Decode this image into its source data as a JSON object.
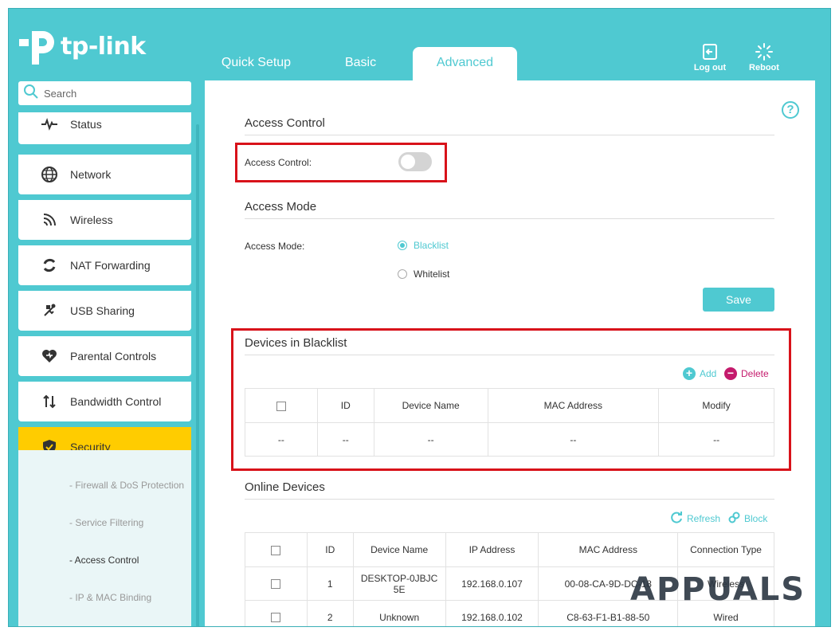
{
  "brand": {
    "name": "tp-link",
    "accent": "#4fc9d1",
    "active_menu": "#ffcc00",
    "highlight": "#d8121a"
  },
  "tabs": [
    {
      "label": "Quick Setup"
    },
    {
      "label": "Basic"
    },
    {
      "label": "Advanced",
      "active": true
    }
  ],
  "header_buttons": {
    "logout": "Log out",
    "reboot": "Reboot"
  },
  "search": {
    "placeholder": "Search"
  },
  "sidebar": {
    "items": [
      {
        "label": "Status",
        "icon": "pulse-icon"
      },
      {
        "label": "Network",
        "icon": "globe-icon"
      },
      {
        "label": "Wireless",
        "icon": "wifi-icon"
      },
      {
        "label": "NAT Forwarding",
        "icon": "refresh-icon"
      },
      {
        "label": "USB Sharing",
        "icon": "usb-icon"
      },
      {
        "label": "Parental Controls",
        "icon": "heart-icon"
      },
      {
        "label": "Bandwidth Control",
        "icon": "arrows-updown-icon"
      },
      {
        "label": "Security",
        "icon": "shield-icon",
        "active": true
      }
    ],
    "subitems": [
      {
        "label": "- Firewall & DoS Protection"
      },
      {
        "label": "- Service Filtering"
      },
      {
        "label": "- Access Control",
        "active": true
      },
      {
        "label": "- IP & MAC Binding"
      }
    ]
  },
  "access_control": {
    "section_title": "Access Control",
    "toggle_label": "Access Control:",
    "enabled": false
  },
  "access_mode": {
    "section_title": "Access Mode",
    "label": "Access Mode:",
    "options": [
      "Blacklist",
      "Whitelist"
    ],
    "selected": "Blacklist",
    "save_label": "Save"
  },
  "blacklist": {
    "section_title": "Devices in Blacklist",
    "add_label": "Add",
    "delete_label": "Delete",
    "columns": [
      "",
      "ID",
      "Device Name",
      "MAC Address",
      "Modify"
    ],
    "rows": [
      [
        "--",
        "--",
        "--",
        "--",
        "--"
      ]
    ]
  },
  "online_devices": {
    "section_title": "Online Devices",
    "refresh_label": "Refresh",
    "block_label": "Block",
    "columns": [
      "",
      "ID",
      "Device Name",
      "IP Address",
      "MAC Address",
      "Connection Type"
    ],
    "rows": [
      {
        "id": "1",
        "name": "DESKTOP-0JBJC5E",
        "ip": "192.168.0.107",
        "mac": "00-08-CA-9D-DC-18",
        "type": "Wireless"
      },
      {
        "id": "2",
        "name": "Unknown",
        "ip": "192.168.0.102",
        "mac": "C8-63-F1-B1-88-50",
        "type": "Wired"
      }
    ]
  },
  "watermark": "APPUALS"
}
